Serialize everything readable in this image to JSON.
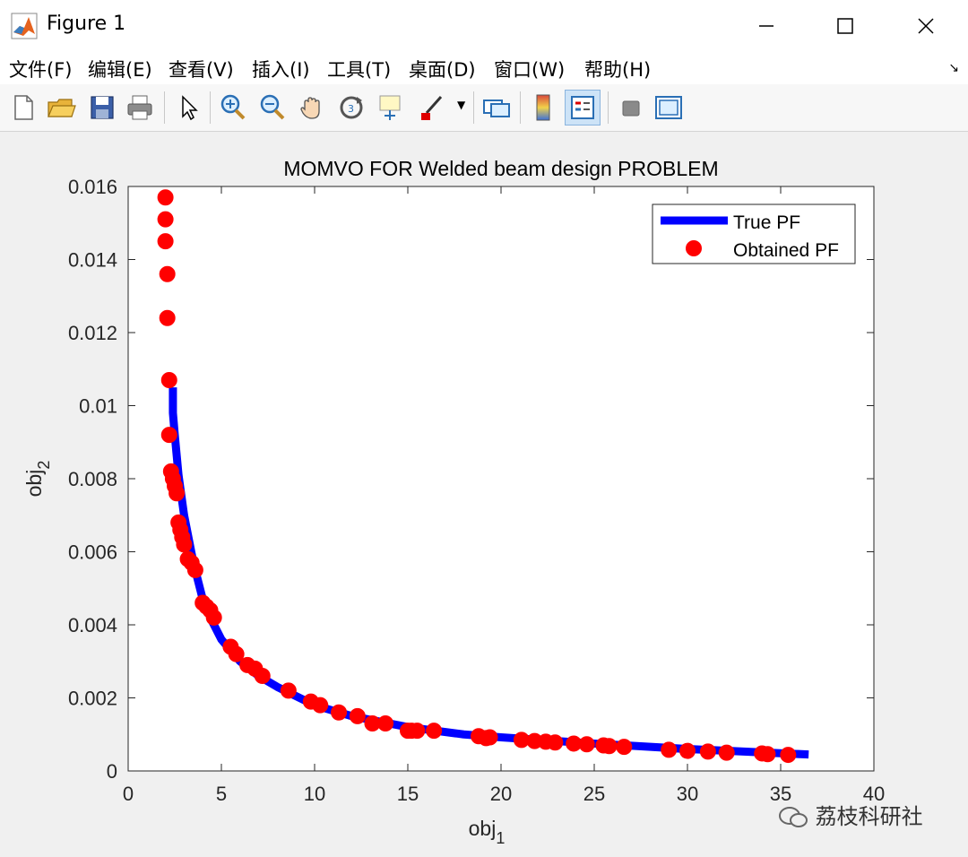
{
  "window": {
    "title": "Figure 1"
  },
  "menu": [
    "文件(F)",
    "编辑(E)",
    "查看(V)",
    "插入(I)",
    "工具(T)",
    "桌面(D)",
    "窗口(W)",
    "帮助(H)"
  ],
  "toolbar": [
    "new-icon",
    "open-icon",
    "save-icon",
    "print-icon",
    "pointer-icon",
    "zoom-in-icon",
    "zoom-out-icon",
    "pan-icon",
    "rotate-icon",
    "data-cursor-icon",
    "brush-icon",
    "link-icon",
    "colorbar-icon",
    "legend-icon",
    "hide-plot-icon",
    "plot-tools-icon"
  ],
  "watermark": "荔枝科研社",
  "chart_data": {
    "type": "scatter",
    "title": "MOMVO FOR Welded beam design PROBLEM",
    "xlabel": "obj",
    "xlabel_sub": "1",
    "ylabel": "obj",
    "ylabel_sub": "2",
    "xlim": [
      0,
      40
    ],
    "ylim": [
      0,
      0.016
    ],
    "xticks": [
      0,
      5,
      10,
      15,
      20,
      25,
      30,
      35,
      40
    ],
    "yticks": [
      0,
      0.002,
      0.004,
      0.006,
      0.008,
      0.01,
      0.012,
      0.014,
      0.016
    ],
    "ytick_labels": [
      "0",
      "0.002",
      "0.004",
      "0.006",
      "0.008",
      "0.01",
      "0.012",
      "0.014",
      "0.016"
    ],
    "legend_position": "top-right",
    "series": [
      {
        "name": "True PF",
        "style": "line",
        "color": "#0000ff",
        "x": [
          2.4,
          2.4,
          2.5,
          2.7,
          3.0,
          3.5,
          4.0,
          4.5,
          5.0,
          6.0,
          7.0,
          8.0,
          10.0,
          12.0,
          15.0,
          18.0,
          20.0,
          25.0,
          30.0,
          36.5
        ],
        "y": [
          0.0105,
          0.0098,
          0.0092,
          0.0081,
          0.007,
          0.0057,
          0.0047,
          0.0041,
          0.0036,
          0.003,
          0.0026,
          0.0023,
          0.0018,
          0.0015,
          0.0012,
          0.001,
          0.00092,
          0.00075,
          0.0006,
          0.00045
        ]
      },
      {
        "name": "Obtained PF",
        "style": "marker",
        "color": "#ff0000",
        "x": [
          2.0,
          2.0,
          2.0,
          2.1,
          2.1,
          2.2,
          2.2,
          2.3,
          2.4,
          2.5,
          2.6,
          2.7,
          2.8,
          2.9,
          3.0,
          3.2,
          3.4,
          3.6,
          4.0,
          4.2,
          4.4,
          4.6,
          5.5,
          5.8,
          6.4,
          6.8,
          7.2,
          8.6,
          9.8,
          10.3,
          11.3,
          12.3,
          13.1,
          13.8,
          15.0,
          15.2,
          15.5,
          16.4,
          18.8,
          19.2,
          19.4,
          21.1,
          21.8,
          22.4,
          22.9,
          23.9,
          24.6,
          25.5,
          25.8,
          26.6,
          29.0,
          30.0,
          31.1,
          32.1,
          34.0,
          34.3,
          35.4
        ],
        "y": [
          0.0157,
          0.0151,
          0.0145,
          0.0136,
          0.0124,
          0.0107,
          0.0092,
          0.0082,
          0.008,
          0.0078,
          0.0076,
          0.0068,
          0.0066,
          0.0064,
          0.0062,
          0.0058,
          0.0057,
          0.0055,
          0.0046,
          0.0045,
          0.0044,
          0.0042,
          0.0034,
          0.0032,
          0.0029,
          0.0028,
          0.0026,
          0.0022,
          0.0019,
          0.0018,
          0.0016,
          0.0015,
          0.0013,
          0.0013,
          0.0011,
          0.0011,
          0.0011,
          0.0011,
          0.00095,
          0.0009,
          0.00092,
          0.00085,
          0.00082,
          0.0008,
          0.00078,
          0.00075,
          0.00073,
          0.0007,
          0.00068,
          0.00066,
          0.00058,
          0.00055,
          0.00053,
          0.0005,
          0.00048,
          0.00046,
          0.00044
        ]
      }
    ]
  }
}
